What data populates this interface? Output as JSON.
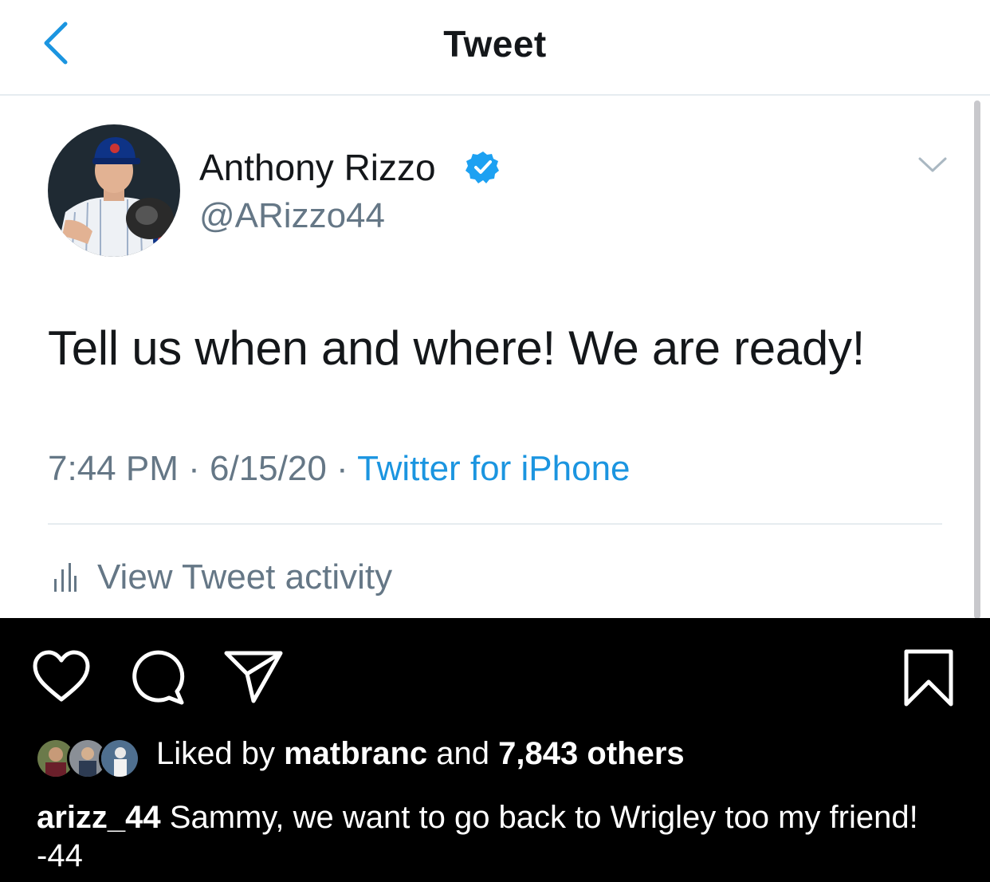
{
  "header": {
    "title": "Tweet",
    "back_icon": "chevron-left-icon"
  },
  "tweet": {
    "author_name": "Anthony Rizzo",
    "handle": "@ARizzo44",
    "verified": true,
    "text": "Tell us when and where! We are ready!",
    "time": "7:44 PM",
    "date": "6/15/20",
    "source": "Twitter for iPhone",
    "separator": "·",
    "activity_label": "View Tweet activity"
  },
  "instagram": {
    "icons": [
      "heart-icon",
      "comment-icon",
      "share-icon",
      "bookmark-icon"
    ],
    "liked_prefix": "Liked by",
    "liked_user": "matbranc",
    "liked_and": "and",
    "liked_others": "7,843 others",
    "caption_user": "arizz_44",
    "caption_text": "Sammy, we want to go back to Wrigley too my friend! -44"
  },
  "colors": {
    "twitter_blue": "#1b95e0",
    "secondary_text": "#657786",
    "primary_text": "#14171a",
    "ig_background": "#000000"
  }
}
